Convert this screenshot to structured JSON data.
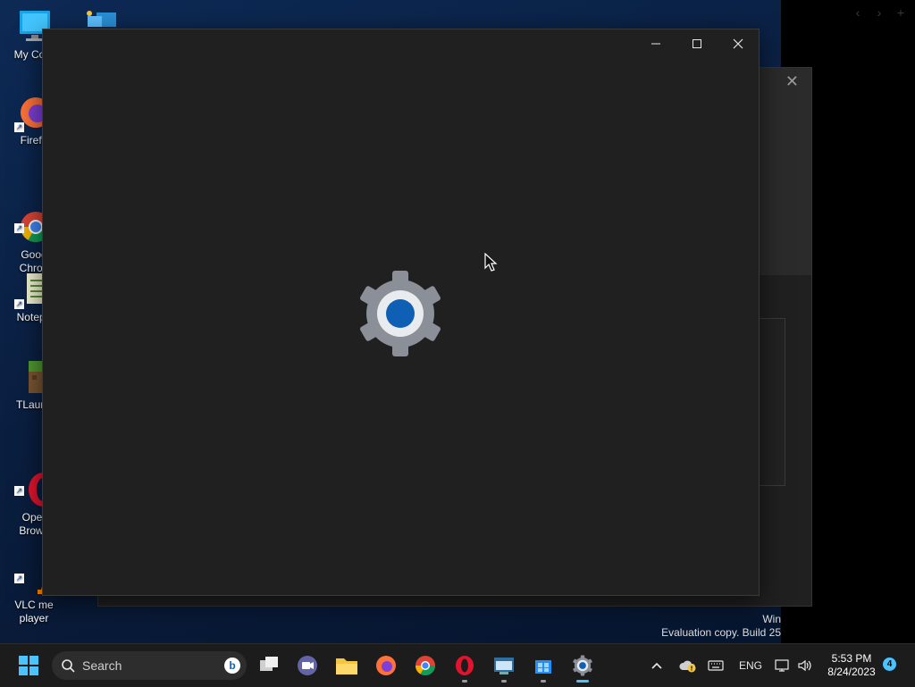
{
  "desktop": {
    "icons": [
      {
        "name": "my-computer",
        "label": "My Com"
      },
      {
        "name": "network",
        "label": ""
      },
      {
        "name": "firefox",
        "label": "Firefo"
      },
      {
        "name": "chrome",
        "label": "Goog\nChron"
      },
      {
        "name": "notepad",
        "label": "Notepa"
      },
      {
        "name": "tlauncher",
        "label": "TLaunc"
      },
      {
        "name": "opera",
        "label": "Oper\nBrows"
      },
      {
        "name": "vlc",
        "label": "VLC me\nplayer"
      }
    ]
  },
  "watermark": {
    "line1": "Win",
    "line2": "Evaluation copy. Build 25"
  },
  "taskbar": {
    "search_label": "Search",
    "language": "ENG",
    "time": "5:53 PM",
    "date": "8/24/2023",
    "notification_count": "4"
  },
  "colors": {
    "accent": "#4cc2ff",
    "gear_center": "#0f5fb5",
    "window_bg": "#202020"
  }
}
